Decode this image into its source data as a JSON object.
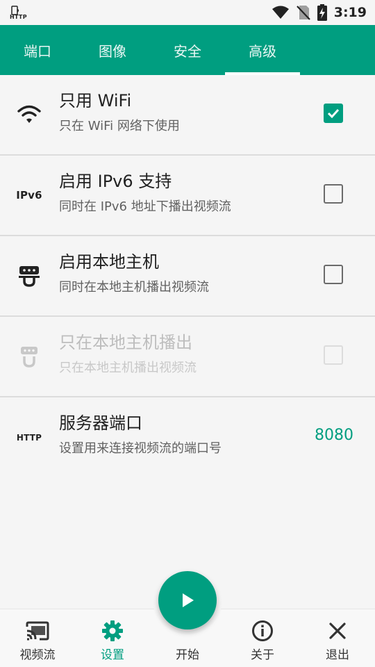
{
  "status_bar": {
    "small_label": "HTTP",
    "time": "3:19",
    "icons": [
      "cast-indicator-icon",
      "wifi-icon",
      "no-sim-icon",
      "battery-charging-icon"
    ]
  },
  "tabs": [
    {
      "label": "端口",
      "active": false
    },
    {
      "label": "图像",
      "active": false
    },
    {
      "label": "安全",
      "active": false
    },
    {
      "label": "高级",
      "active": true
    }
  ],
  "settings": [
    {
      "icon": "wifi-icon",
      "title": "只用 WiFi",
      "subtitle": "只在 WiFi 网络下使用",
      "checked": true,
      "enabled": true
    },
    {
      "icon": "ipv6-icon",
      "icon_text": "IPv6",
      "title": "启用 IPv6 支持",
      "subtitle": "同时在 IPv6 地址下播出视频流",
      "checked": false,
      "enabled": true
    },
    {
      "icon": "localhost-icon",
      "title": "启用本地主机",
      "subtitle": "同时在本地主机播出视频流",
      "checked": false,
      "enabled": true
    },
    {
      "icon": "localhost-only-icon",
      "title": "只在本地主机播出",
      "subtitle": "只在本地主机播出视频流",
      "checked": false,
      "enabled": false
    },
    {
      "icon": "http-icon",
      "icon_text": "HTTP",
      "title": "服务器端口",
      "subtitle": "设置用来连接视频流的端口号",
      "value": "8080",
      "enabled": true
    }
  ],
  "bottom_nav": [
    {
      "icon": "cast-icon",
      "label": "视频流",
      "active": false
    },
    {
      "icon": "gear-icon",
      "label": "设置",
      "active": true
    },
    {
      "icon": "play-icon",
      "label": "开始",
      "active": false
    },
    {
      "icon": "info-icon",
      "label": "关于",
      "active": false
    },
    {
      "icon": "close-icon",
      "label": "退出",
      "active": false
    }
  ],
  "colors": {
    "accent": "#009e80",
    "background": "#f5f5f5",
    "divider": "#dcdcdc"
  }
}
